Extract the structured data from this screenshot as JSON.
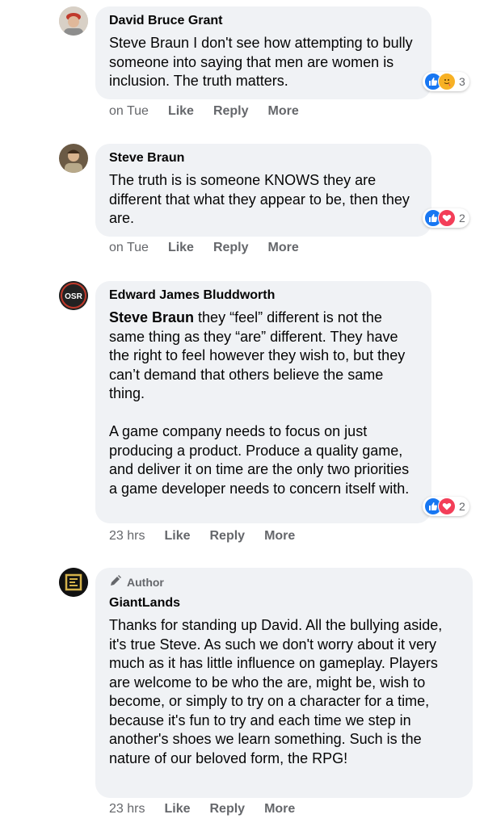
{
  "comments": [
    {
      "name": "David Bruce Grant",
      "text": "Steve Braun I don't see how attempting to bully someone into saying that men are women is inclusion. The truth matters.",
      "reaction_count": "3",
      "reactions": [
        "like-icon",
        "care-icon"
      ],
      "time": "on Tue",
      "like": "Like",
      "reply": "Reply",
      "more": "More"
    },
    {
      "name": "Steve Braun",
      "text": "The truth is is someone KNOWS they are different that what they appear to be, then they are.",
      "reaction_count": "2",
      "reactions": [
        "like-icon",
        "love-icon"
      ],
      "time": "on Tue",
      "like": "Like",
      "reply": "Reply",
      "more": "More"
    },
    {
      "name": "Edward James Bluddworth",
      "mention": "Steve Braun",
      "text": " they “feel” different is not the same thing as they “are” different. They have the right to feel however they wish to, but they can’t demand that others believe the same thing.\n\nA game company needs to focus on just producing a product. Produce a quality game, and deliver it on time are the only two priorities a game developer needs to concern itself with.",
      "reaction_count": "2",
      "reactions": [
        "like-icon",
        "love-icon"
      ],
      "time": "23 hrs",
      "like": "Like",
      "reply": "Reply",
      "more": "More",
      "avatar_text": "OSR"
    },
    {
      "badge": "Author",
      "name": "GiantLands",
      "text": "Thanks for standing up David. All the bullying aside, it's true Steve. As such we don't worry about it very much as it has little influence on gameplay. Players are welcome to be who the are, might be, wish to become, or simply to try on a character for a time, because it's fun to try and each time we step in another's shoes we learn something. Such is the nature of our beloved form, the RPG!",
      "time": "23 hrs",
      "like": "Like",
      "reply": "Reply",
      "more": "More"
    }
  ],
  "colors": {
    "like_blue": "#1877f2",
    "love_red": "#f33e58",
    "care_yellow": "#f7b125",
    "meta_gray": "#65676b",
    "bubble": "#f0f2f5"
  }
}
